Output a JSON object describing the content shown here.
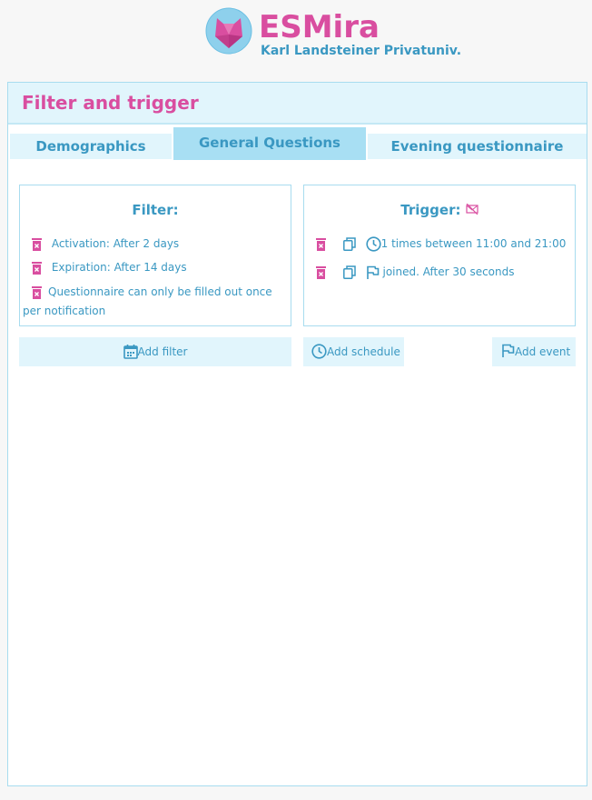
{
  "header": {
    "brand": "ESMira",
    "subtitle": "Karl Landsteiner Privatuniv."
  },
  "panel": {
    "title": "Filter and trigger"
  },
  "tabs": [
    {
      "label": "Demographics",
      "active": false
    },
    {
      "label": "General Questions",
      "active": true
    },
    {
      "label": "Evening questionnaire",
      "active": false
    }
  ],
  "filter": {
    "title": "Filter:",
    "items": [
      "Activation: After 2 days",
      "Expiration: After 14 days",
      "Questionnaire can only be filled out once per notification"
    ],
    "add_label": "Add filter"
  },
  "trigger": {
    "title": "Trigger:",
    "items": [
      {
        "icon": "clock-icon",
        "text": "1 times between 11:00 and 21:00"
      },
      {
        "icon": "flag-icon",
        "text": "joined. After 30 seconds"
      }
    ],
    "add_schedule_label": "Add schedule",
    "add_event_label": "Add event"
  },
  "colors": {
    "accent": "#d94ea0",
    "primary": "#3a98c2",
    "light": "#e1f5fc",
    "active_tab": "#a8dff3"
  }
}
